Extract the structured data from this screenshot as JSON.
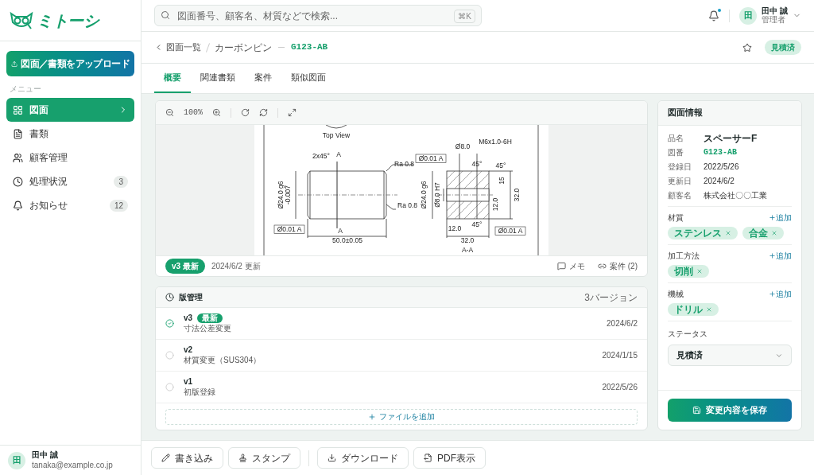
{
  "logo": {
    "text": "ミトーシ"
  },
  "search": {
    "placeholder": "図面番号、顧客名、材質などで検索...",
    "shortcut": "⌘K"
  },
  "header": {
    "notification_dot": true,
    "user": {
      "initial": "田",
      "name": "田中 誠",
      "role": "管理者"
    }
  },
  "sidebar": {
    "upload_button": "図面／書類をアップロード",
    "section_label": "メニュー",
    "items": [
      {
        "label": "図面",
        "selected": true
      },
      {
        "label": "書類",
        "selected": false
      },
      {
        "label": "顧客管理",
        "selected": false
      },
      {
        "label": "処理状況",
        "selected": false,
        "badge": "3"
      },
      {
        "label": "お知らせ",
        "selected": false,
        "badge": "12"
      }
    ]
  },
  "sidebar_user": {
    "initial": "田",
    "name": "田中 誠",
    "email": "tanaka@example.co.jp"
  },
  "breadcrumb": {
    "back": "図面一覧",
    "category": "カーボンピン",
    "current": "G123-AB"
  },
  "starred": false,
  "status_badge": "見積済",
  "tabs": [
    {
      "label": "概要",
      "selected": true
    },
    {
      "label": "関連書類",
      "selected": false
    },
    {
      "label": "案件",
      "selected": false
    },
    {
      "label": "類似図面",
      "selected": false
    }
  ],
  "viewer": {
    "zoom": "100%",
    "drawing": {
      "labels": [
        "Top View",
        "2x45°",
        "A",
        "Ra 0.8",
        "Ø24.0 g6",
        "-0.007",
        "Ra 0.8",
        "Ø0.01 A",
        "A",
        "50.0±0.05",
        "Ø8.0",
        "M6x1.0-6H",
        "Ø0.01 A",
        "45°",
        "45°",
        "Ø24.0 g6",
        "Ø8.0 H7",
        "15",
        "12.0",
        "32.0",
        "45°",
        "12.0",
        "Ø0.01 A",
        "32.0",
        "A-A"
      ]
    },
    "version_badge": "v3 最新",
    "updated": "2024/6/2 更新",
    "memo": "メモ",
    "cases": "案件 (2)"
  },
  "versions": {
    "title": "版管理",
    "count": "3バージョン",
    "items": [
      {
        "version": "v3",
        "badge": "最新",
        "note": "寸法公差変更",
        "date": "2024/6/2",
        "selected": true
      },
      {
        "version": "v2",
        "note": "材質変更（SUS304）",
        "date": "2024/1/15",
        "selected": false
      },
      {
        "version": "v1",
        "note": "初版登録",
        "date": "2022/5/26",
        "selected": false
      }
    ],
    "add_file": "ファイルを追加"
  },
  "info": {
    "title": "図面情報",
    "fields": [
      {
        "label": "品名",
        "value": "スペーサーF",
        "kind": "bold"
      },
      {
        "label": "図番",
        "value": "G123-AB",
        "kind": "code"
      },
      {
        "label": "登録日",
        "value": "2022/5/26",
        "kind": "plain"
      },
      {
        "label": "更新日",
        "value": "2024/6/2",
        "kind": "plain"
      },
      {
        "label": "顧客名",
        "value": "株式会社〇〇工業",
        "kind": "plain"
      }
    ],
    "tag_groups": [
      {
        "label": "材質",
        "add": "追加",
        "tags": [
          "ステンレス",
          "合金"
        ]
      },
      {
        "label": "加工方法",
        "add": "追加",
        "tags": [
          "切削"
        ]
      },
      {
        "label": "機械",
        "add": "追加",
        "tags": [
          "ドリル"
        ]
      }
    ],
    "status": {
      "label": "ステータス",
      "value": "見積済"
    },
    "save": "変更内容を保存"
  },
  "actions": [
    "書き込み",
    "スタンプ",
    "ダウンロード",
    "PDF表示"
  ]
}
